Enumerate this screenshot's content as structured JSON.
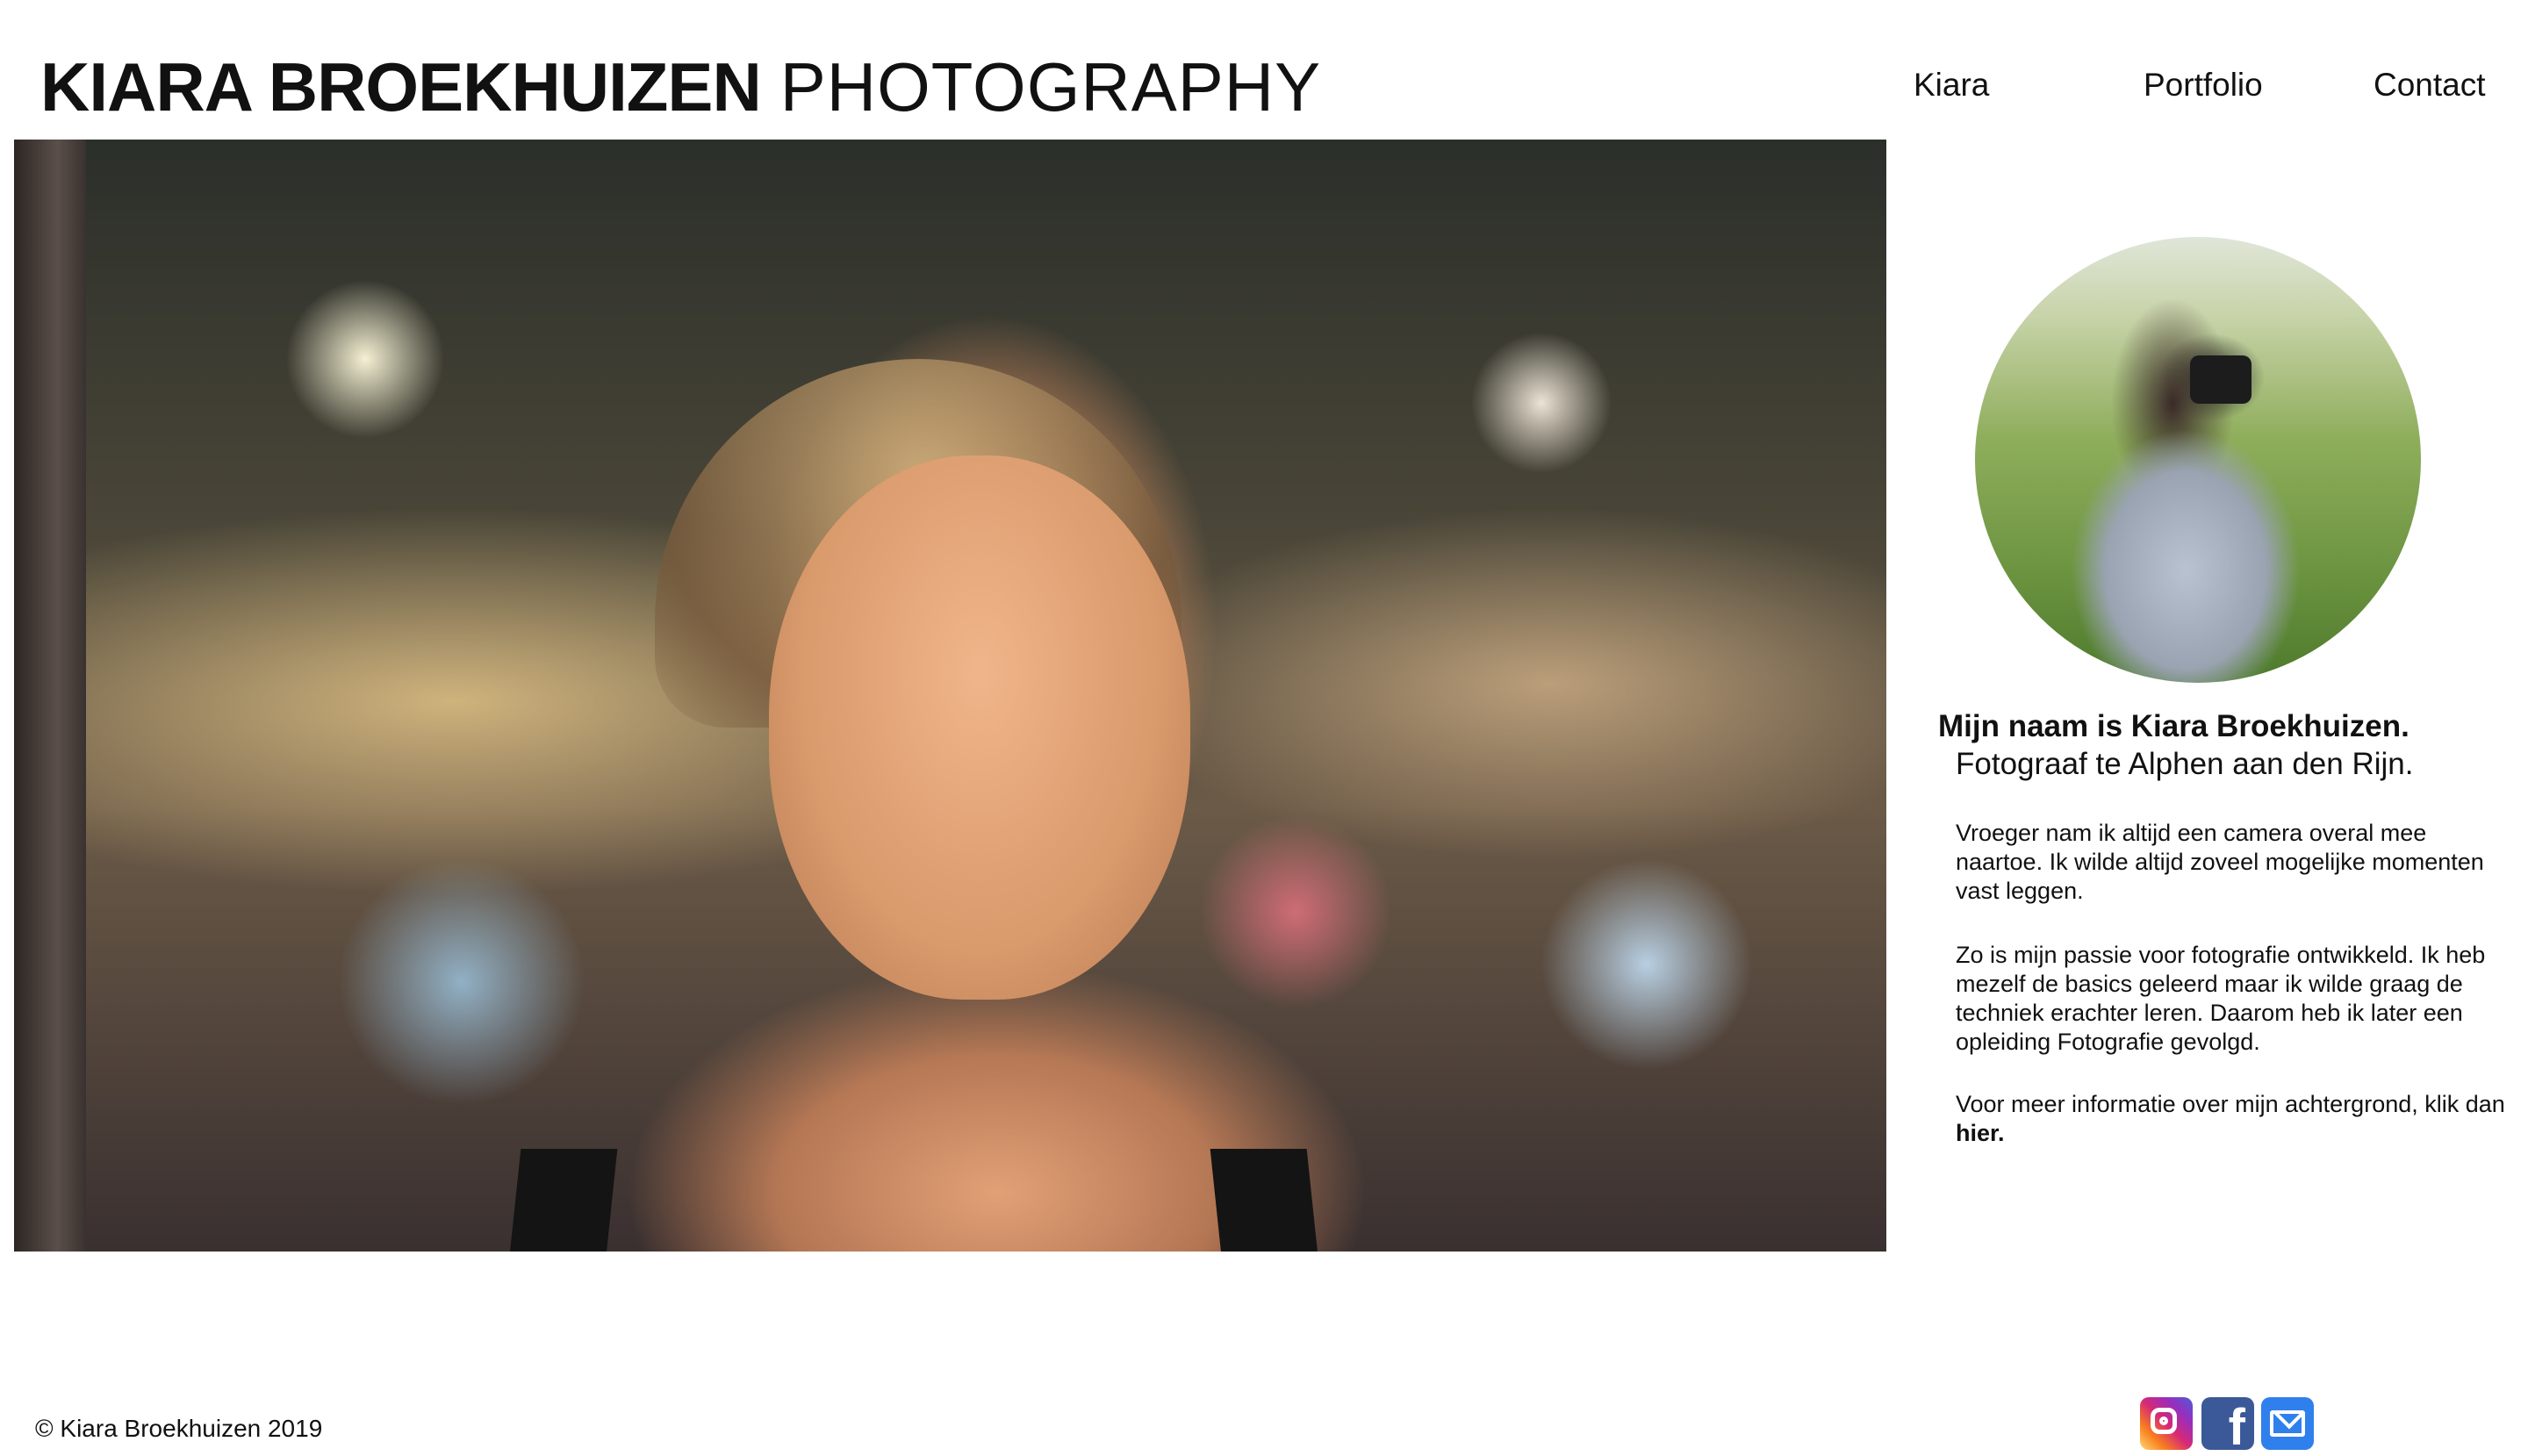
{
  "header": {
    "logo_bold": "KIARA BROEKHUIZEN",
    "logo_light": "PHOTOGRAPHY",
    "nav": [
      "Kiara",
      "Portfolio",
      "Contact"
    ]
  },
  "about": {
    "title": "Mijn naam is Kiara Broekhuizen.",
    "subtitle": "Fotograaf te Alphen aan den Rijn.",
    "paragraph1": "Vroeger nam ik altijd een camera overal mee naartoe. Ik wilde altijd zoveel mogelijke momenten vast leggen.",
    "paragraph2": "Zo is mijn passie voor fotografie ontwikkeld. Ik heb mezelf de basics geleerd maar ik wilde graag de techniek erachter leren. Daarom heb ik later een opleiding Fotografie gevolgd.",
    "paragraph3_text": "Voor meer informatie over mijn achtergrond, klik dan ",
    "paragraph3_link": "hier."
  },
  "footer": {
    "copyright": "© Kiara Broekhuizen 2019",
    "social_icons": [
      "instagram-icon",
      "facebook-icon",
      "mail-icon"
    ]
  },
  "colors": {
    "text": "#111111",
    "background": "#ffffff",
    "facebook": "#3b5998",
    "mail": "#2f80ed"
  }
}
